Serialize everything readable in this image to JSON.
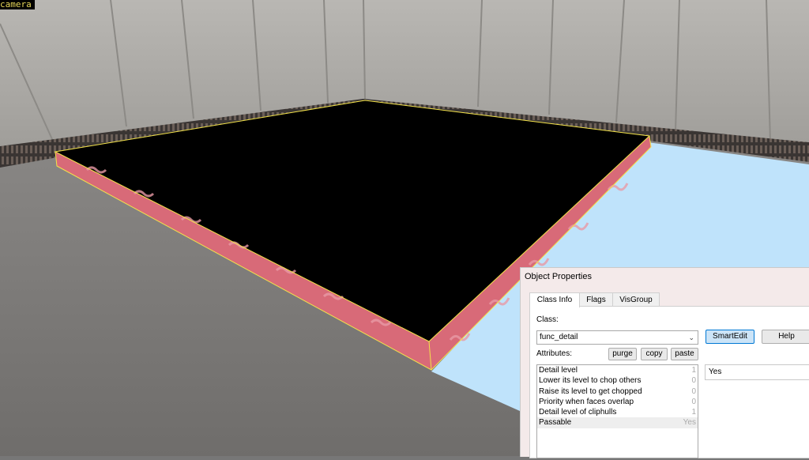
{
  "viewport": {
    "label": "camera",
    "colors": {
      "sky": "#bfe3fb",
      "floor": "#8a8785",
      "wall": "#a9a7a3",
      "brush_top": "#000000",
      "brush_side": "#d86a78",
      "outline": "#f3e24a"
    }
  },
  "dialog": {
    "title": "Object Properties",
    "tabs": [
      "Class Info",
      "Flags",
      "VisGroup"
    ],
    "class_label": "Class:",
    "class_value": "func_detail",
    "smartedit_label": "SmartEdit",
    "help_label": "Help",
    "attributes_label": "Attributes:",
    "purge_label": "purge",
    "copy_label": "copy",
    "paste_label": "paste",
    "attributes": [
      {
        "name": "Detail level",
        "value": "1"
      },
      {
        "name": "Lower its level to chop others",
        "value": "0"
      },
      {
        "name": "Raise its level to get chopped",
        "value": "0"
      },
      {
        "name": "Priority when faces overlap",
        "value": "0"
      },
      {
        "name": "Detail level of cliphulls",
        "value": "1"
      },
      {
        "name": "Passable",
        "value": "Yes"
      }
    ],
    "selected_value": "Yes"
  }
}
